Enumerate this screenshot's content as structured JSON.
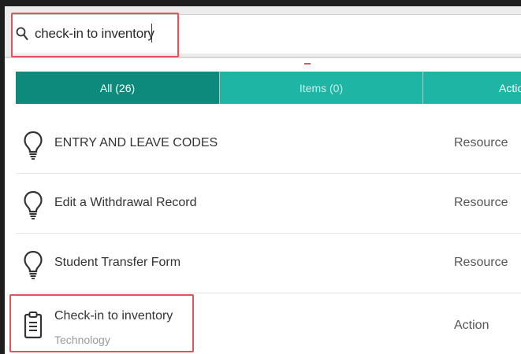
{
  "search": {
    "value": "check-in to inventory",
    "icon": "search-icon"
  },
  "tabs": [
    {
      "label": "All (26)",
      "active": true
    },
    {
      "label": "Items (0)",
      "active": false
    },
    {
      "label": "Actio",
      "active": false
    }
  ],
  "results": [
    {
      "title": "ENTRY AND LEAVE CODES",
      "subtitle": "",
      "type": "Resource",
      "icon": "lightbulb-icon"
    },
    {
      "title": "Edit a Withdrawal Record",
      "subtitle": "",
      "type": "Resource",
      "icon": "lightbulb-icon"
    },
    {
      "title": "Student Transfer Form",
      "subtitle": "",
      "type": "Resource",
      "icon": "lightbulb-icon"
    },
    {
      "title": "Check-in to inventory",
      "subtitle": "Technology",
      "type": "Action",
      "icon": "clipboard-icon"
    }
  ],
  "colors": {
    "tab_active": "#0e8a7c",
    "tab_inactive": "#1fb5a4",
    "highlight": "#e4525a"
  }
}
